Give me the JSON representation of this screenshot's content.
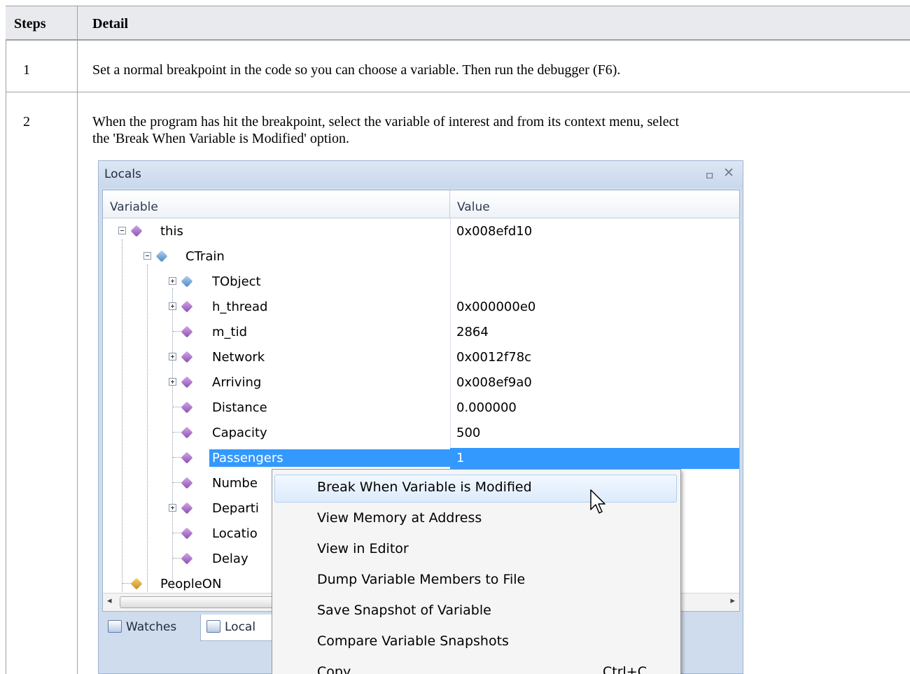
{
  "table": {
    "col_steps": "Steps",
    "col_detail": "Detail",
    "rows": [
      {
        "step": "1",
        "detail": "Set a normal breakpoint in the code so you can choose a variable. Then run the debugger (F6)."
      },
      {
        "step": "2",
        "detail_line1": "When the program has hit the breakpoint, select the variable of interest and from its context menu, select",
        "detail_line2": "the 'Break When Variable is Modified' option."
      }
    ]
  },
  "locals": {
    "title": "Locals",
    "pin_icon": "📌",
    "close_icon": "✕",
    "columns": {
      "variable": "Variable",
      "value": "Value"
    },
    "rows": [
      {
        "name": "this",
        "value": "0x008efd10"
      },
      {
        "name": "CTrain",
        "value": ""
      },
      {
        "name": "TObject",
        "value": ""
      },
      {
        "name": "h_thread",
        "value": "0x000000e0"
      },
      {
        "name": "m_tid",
        "value": "2864"
      },
      {
        "name": "Network",
        "value": "0x0012f78c"
      },
      {
        "name": "Arriving",
        "value": "0x008ef9a0"
      },
      {
        "name": "Distance",
        "value": "0.000000"
      },
      {
        "name": "Capacity",
        "value": "500"
      },
      {
        "name": "Passengers",
        "value": "1"
      },
      {
        "name": "Numbe",
        "value": ""
      },
      {
        "name": "Departi",
        "value": ""
      },
      {
        "name": "Locatio",
        "value": ""
      },
      {
        "name": "Delay",
        "value": ""
      },
      {
        "name": "PeopleON",
        "value": ""
      }
    ],
    "scroll_left": "◂",
    "scroll_right": "▸",
    "tabs": [
      {
        "label": "Watches"
      },
      {
        "label": "Local"
      }
    ]
  },
  "context_menu": {
    "items": [
      {
        "label": "Break When Variable is Modified",
        "shortcut": ""
      },
      {
        "label": "View Memory at Address",
        "shortcut": ""
      },
      {
        "label": "View in Editor",
        "shortcut": ""
      },
      {
        "label": "Dump Variable Members to File",
        "shortcut": ""
      },
      {
        "label": "Save Snapshot of Variable",
        "shortcut": ""
      },
      {
        "label": "Compare Variable Snapshots",
        "shortcut": ""
      },
      {
        "label": "Copy",
        "shortcut": "Ctrl+C"
      }
    ]
  },
  "colors": {
    "selection": "#3399ff",
    "pane_bg": "#cfdcee",
    "header_bg": "#e8eaed"
  }
}
